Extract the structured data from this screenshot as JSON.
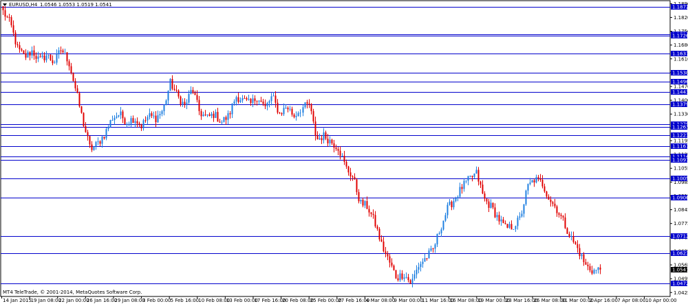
{
  "header": {
    "symbol_label": "EURUSD,H4",
    "ohlc_text": "1.0546 1.0553 1.0519 1.0541"
  },
  "footer": {
    "copyright": "MT4 TeleTrade, © 2001-2014, MetaQuotes Software Corp."
  },
  "colors": {
    "background": "#ffffff",
    "frame": "#000000",
    "bull_candle": "#1e7fe0",
    "bear_candle": "#e00000",
    "level_line": "#0000cc",
    "level_label_bg": "#0000cc",
    "current_price_bg": "#000000"
  },
  "chart_data": {
    "type": "candlestick",
    "symbol": "EURUSD",
    "timeframe": "H4",
    "last_ohlc": {
      "open": 1.0546,
      "high": 1.0553,
      "low": 1.0519,
      "close": 1.0541
    },
    "ylim": [
      1.0405,
      1.1905
    ],
    "y_ticks": [
      "1.1890",
      "1.1820",
      "1.1750",
      "1.1680",
      "1.1610",
      "1.1540",
      "1.1470",
      "1.1400",
      "1.1330",
      "1.1260",
      "1.1195",
      "1.1125",
      "1.1055",
      "1.0985",
      "1.0915",
      "1.0845",
      "1.0775",
      "1.0705",
      "1.0635",
      "1.0565",
      "1.0495",
      "1.0425"
    ],
    "x_ticks": [
      "14 Jan 2015",
      "19 Jan 08:00",
      "22 Jan 00:00",
      "26 Jan 16:00",
      "29 Jan 08:00",
      "3 Feb 00:00",
      "5 Feb 16:00",
      "10 Feb 08:00",
      "13 Feb 00:00",
      "17 Feb 16:00",
      "20 Feb 08:00",
      "25 Feb 00:00",
      "27 Feb 16:00",
      "4 Mar 08:00",
      "9 Mar 00:00",
      "11 Mar 16:00",
      "16 Mar 08:00",
      "19 Mar 00:00",
      "23 Mar 16:00",
      "26 Mar 08:00",
      "31 Mar 00:00",
      "2 Apr 16:00",
      "7 Apr 08:00",
      "10 Apr 00:00"
    ],
    "levels": [
      "1.1872",
      "1.1735",
      "1.1726",
      "1.1637",
      "1.1538",
      "1.1496",
      "1.1443",
      "1.1379",
      "1.1279",
      "1.1263",
      "1.1223",
      "1.1167",
      "1.1114",
      "1.1097",
      "1.1005",
      "1.0906",
      "1.0712",
      "1.0623",
      "1.0472"
    ],
    "current_price": "1.0541",
    "price_path": [
      1.185,
      1.179,
      1.166,
      1.162,
      1.165,
      1.16,
      1.163,
      1.159,
      1.166,
      1.16,
      1.145,
      1.129,
      1.115,
      1.118,
      1.123,
      1.131,
      1.133,
      1.129,
      1.131,
      1.127,
      1.132,
      1.131,
      1.135,
      1.149,
      1.142,
      1.137,
      1.146,
      1.134,
      1.131,
      1.133,
      1.129,
      1.132,
      1.142,
      1.14,
      1.138,
      1.142,
      1.136,
      1.142,
      1.133,
      1.137,
      1.132,
      1.136,
      1.138,
      1.12,
      1.122,
      1.119,
      1.116,
      1.106,
      1.101,
      1.088,
      1.086,
      1.078,
      1.066,
      1.058,
      1.05,
      1.052,
      1.047,
      1.056,
      1.06,
      1.064,
      1.075,
      1.085,
      1.09,
      1.096,
      1.1,
      1.103,
      1.09,
      1.086,
      1.08,
      1.075,
      1.076,
      1.08,
      1.096,
      1.1,
      1.098,
      1.09,
      1.085,
      1.078,
      1.07,
      1.064,
      1.056,
      1.0535,
      1.0541
    ]
  }
}
